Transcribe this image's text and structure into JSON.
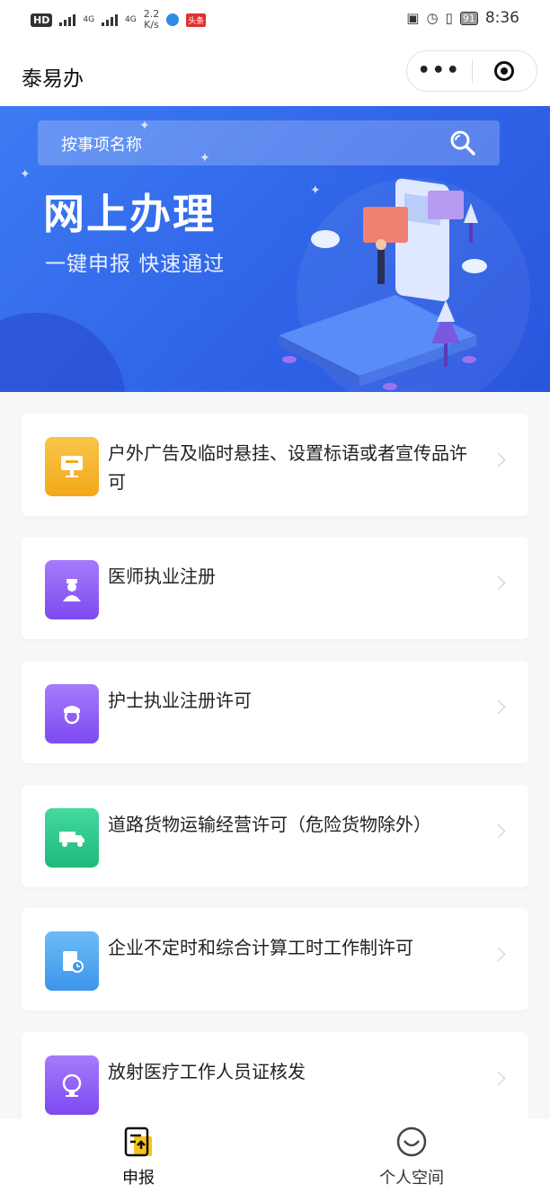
{
  "status_bar": {
    "network_badge": "HD",
    "signal_1": "4G",
    "signal_2": "4G",
    "speed_value": "2.2",
    "speed_unit": "K/s",
    "news_badge": "头条",
    "battery": "91",
    "time": "8:36"
  },
  "navbar": {
    "title": "泰易办",
    "more_label": "•••"
  },
  "banner": {
    "search_placeholder": "按事项名称",
    "title": "网上办理",
    "subtitle": "一键申报  快速通过"
  },
  "services": [
    {
      "label": "户外广告及临时悬挂、设置标语或者宣传品许可",
      "icon": "billboard-icon",
      "color": "#f5b324"
    },
    {
      "label": "医师执业注册",
      "icon": "doctor-icon",
      "color": "#8e5cf5"
    },
    {
      "label": "护士执业注册许可",
      "icon": "nurse-icon",
      "color": "#8e5cf5"
    },
    {
      "label": "道路货物运输经营许可（危险货物除外）",
      "icon": "truck-icon",
      "color": "#2fc98b"
    },
    {
      "label": "企业不定时和综合计算工时工作制许可",
      "icon": "document-clock-icon",
      "color": "#4aa6f0"
    },
    {
      "label": "放射医疗工作人员证核发",
      "icon": "radiation-icon",
      "color": "#8e5cf5"
    }
  ],
  "tabbar": {
    "tabs": [
      {
        "label": "申报",
        "icon": "apply-icon",
        "active": true
      },
      {
        "label": "个人空间",
        "icon": "profile-icon",
        "active": false
      }
    ]
  },
  "colors": {
    "banner_primary": "#3d7bf3",
    "apply_accent": "#f5c518"
  }
}
